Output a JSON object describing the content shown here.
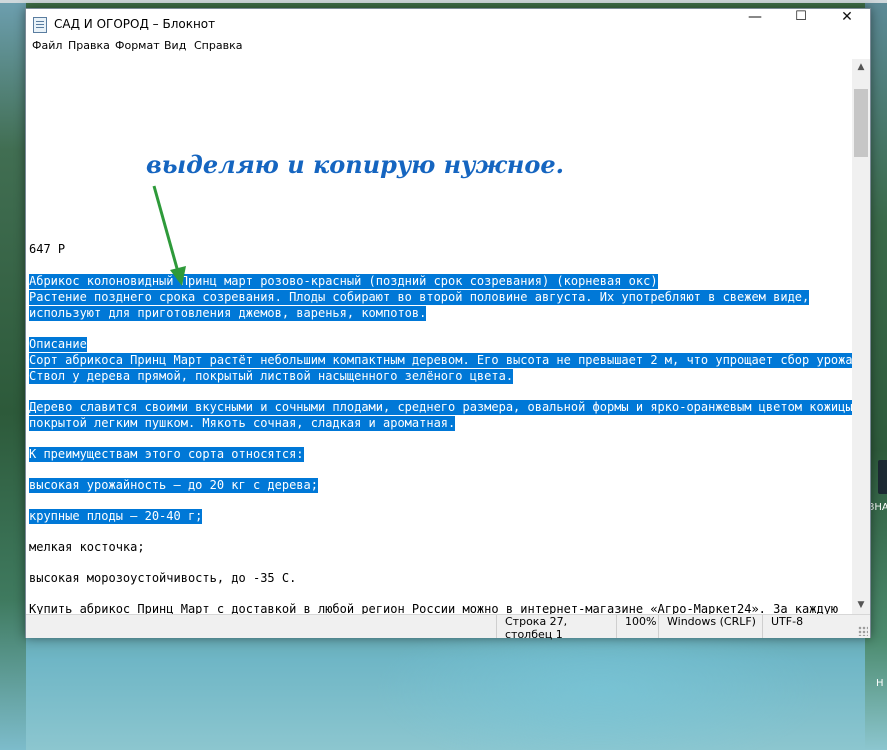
{
  "window": {
    "title": "САД И ОГОРОД – Блокнот",
    "controls": {
      "minimize": "—",
      "maximize": "☐",
      "close": "✕"
    }
  },
  "menu": [
    "Файл",
    "Правка",
    "Формат",
    "Вид",
    "Справка"
  ],
  "annotation": "выделяю и копирую нужное.",
  "editor": {
    "lines": [
      {
        "text": "647 Р",
        "selected": false
      },
      {
        "text": "Абрикос колоновидный Принц март розово-красный (поздний срок созревания) (корневая окс)",
        "selected": true
      },
      {
        "text": "Растение позднего срока созревания. Плоды собирают во второй половине августа. Их употребляют в свежем виде,",
        "selected": true
      },
      {
        "text": "используют для приготовления джемов, варенья, компотов.",
        "selected": true
      },
      {
        "text": "Описание",
        "selected": true
      },
      {
        "text": "Сорт абрикоса Принц Март растёт небольшим компактным деревом. Его высота не превышает 2 м, что упрощает сбор урожая.",
        "selected": true
      },
      {
        "text": "Ствол у дерева прямой, покрытый листвой насыщенного зелёного цвета.",
        "selected": true
      },
      {
        "text": "Дерево славится своими вкусными и сочными плодами, среднего размера, овальной формы и ярко-оранжевым цветом кожицы,",
        "selected": true
      },
      {
        "text": "покрытой легким пушком. Мякоть сочная, сладкая и ароматная.",
        "selected": true
      },
      {
        "text": "К преимуществам этого сорта относятся:",
        "selected": true
      },
      {
        "text": "высокая урожайность – до 20 кг с дерева;",
        "selected": true
      },
      {
        "text": "крупные плоды – 20-40 г;",
        "selected": true
      },
      {
        "text": "мелкая косточка;",
        "selected": false
      },
      {
        "text": "высокая морозоустойчивость, до -35 С.",
        "selected": false
      },
      {
        "text": "Купить абрикос Принц Март с доставкой в любой регион России можно в интернет-магазине «Агро-Маркет24». За каждую",
        "selected": false
      }
    ]
  },
  "status": {
    "position": "Строка 27, столбец 1",
    "zoom": "100%",
    "line_endings": "Windows (CRLF)",
    "encoding": "UTF-8"
  },
  "desktop": {
    "icon_label_1": "ЗНА",
    "icon_label_2": "Н"
  },
  "colors": {
    "selection": "#0078d7",
    "annotation": "#1565c0",
    "arrow": "#2e9a3a"
  }
}
